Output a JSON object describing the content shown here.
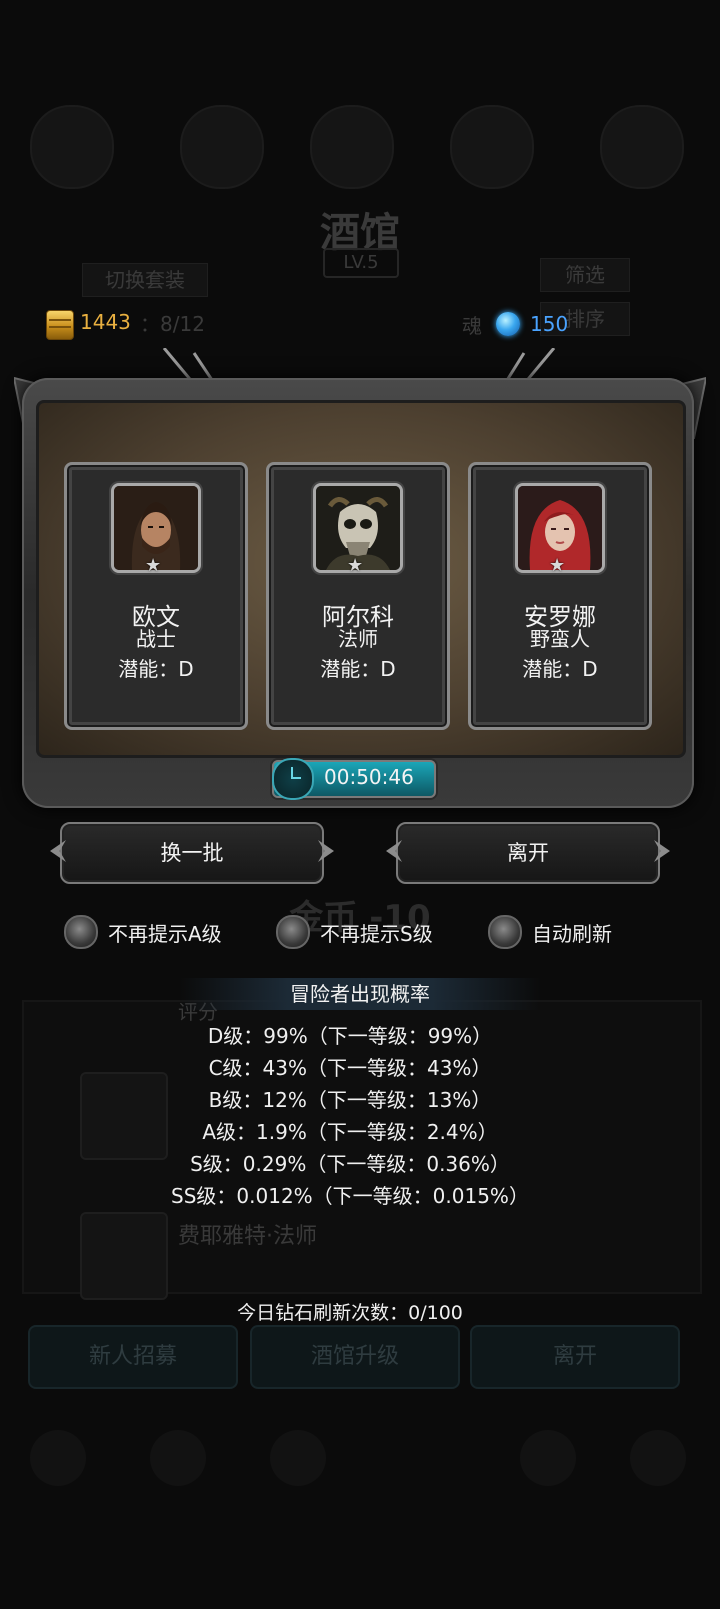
{
  "background": {
    "title": "酒馆",
    "level": "LV.5",
    "switch_outfit": "切换套装",
    "capacity_label": "",
    "capacity_value": "8/12",
    "soul_label": "魂",
    "filter": "筛选",
    "sort": "排序",
    "rating_label": "评分",
    "row_name": "费耶雅特·法师",
    "gold_float": "金币 -10",
    "timer": "00:50:46",
    "bottom_buttons": [
      "新人招募",
      "酒馆升级",
      "离开"
    ]
  },
  "currency": {
    "gold": "1443",
    "gems": "150"
  },
  "heroes": [
    {
      "name": "欧文",
      "class": "战士",
      "potential": "潜能：D",
      "portrait": "warrior-portrait-icon"
    },
    {
      "name": "阿尔科",
      "class": "法师",
      "potential": "潜能：D",
      "portrait": "mage-skull-portrait-icon"
    },
    {
      "name": "安罗娜",
      "class": "野蛮人",
      "potential": "潜能：D",
      "portrait": "barbarian-woman-portrait-icon"
    }
  ],
  "timer": "00:50:46",
  "buttons": {
    "refresh": "换一批",
    "leave": "离开"
  },
  "options": [
    {
      "label": "不再提示A级",
      "checked": false
    },
    {
      "label": "不再提示S级",
      "checked": false
    },
    {
      "label": "自动刷新",
      "checked": false
    }
  ],
  "probability": {
    "title": "冒险者出现概率",
    "lines": [
      "D级：99%（下一等级：99%）",
      "C级：43%（下一等级：43%）",
      "B级：12%（下一等级：13%）",
      "A级：1.9%（下一等级：2.4%）",
      "S级：0.29%（下一等级：0.36%）",
      "SS级：0.012%（下一等级：0.015%）"
    ]
  },
  "refresh_count": "今日钻石刷新次数：0/100",
  "colors": {
    "gold_text": "#e9b040",
    "gem_text": "#4aa3ff",
    "timer_bar": "#1ba6b8",
    "card_border": "#8a8a8a"
  }
}
